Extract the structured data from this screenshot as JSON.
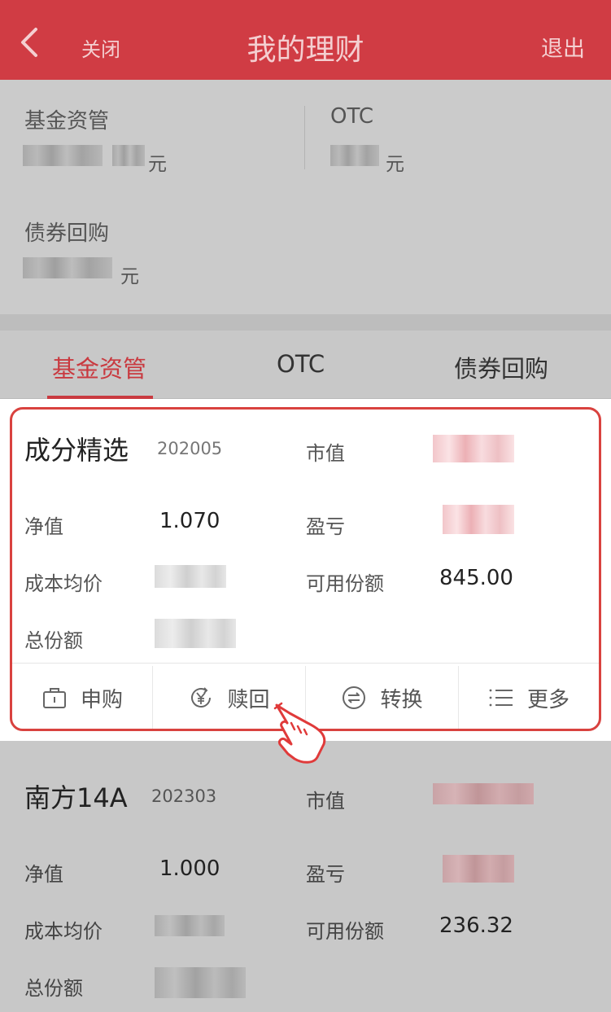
{
  "header": {
    "close_label": "关闭",
    "title": "我的理财",
    "exit_label": "退出"
  },
  "summary": {
    "fund": {
      "label": "基金资管",
      "unit": "元"
    },
    "otc": {
      "label": "OTC",
      "unit": "元"
    },
    "bond": {
      "label": "债券回购",
      "unit": "元"
    }
  },
  "tabs": [
    {
      "label": "基金资管",
      "active": true
    },
    {
      "label": "OTC",
      "active": false
    },
    {
      "label": "债券回购",
      "active": false
    }
  ],
  "funds": [
    {
      "name": "成分精选",
      "code": "202005",
      "market_value_label": "市值",
      "nav_label": "净值",
      "nav": "1.070",
      "pnl_label": "盈亏",
      "cost_label": "成本均价",
      "available_label": "可用份额",
      "available": "845.00",
      "total_label": "总份额"
    },
    {
      "name": "南方14A",
      "code": "202303",
      "market_value_label": "市值",
      "nav_label": "净值",
      "nav": "1.000",
      "pnl_label": "盈亏",
      "cost_label": "成本均价",
      "available_label": "可用份额",
      "available": "236.32",
      "total_label": "总份额"
    }
  ],
  "actions": [
    {
      "label": "申购",
      "icon": "bag-icon"
    },
    {
      "label": "赎回",
      "icon": "yen-icon"
    },
    {
      "label": "转换",
      "icon": "exchange-icon"
    },
    {
      "label": "更多",
      "icon": "list-icon"
    }
  ],
  "colors": {
    "header": "#d03c44",
    "accent": "#c93a40",
    "card_border": "#d9423f"
  }
}
